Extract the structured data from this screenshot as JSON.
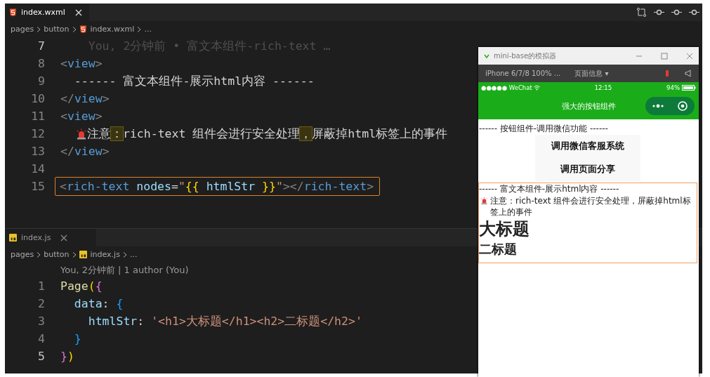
{
  "editor_top": {
    "tab": {
      "label": "index.wxml",
      "kind": "wxml",
      "focused": true
    },
    "breadcrumb": [
      {
        "label": "pages"
      },
      {
        "label": "button"
      },
      {
        "label": "index.wxml",
        "kind": "wxml"
      },
      {
        "label": "..."
      }
    ],
    "lines": [
      {
        "number": "7",
        "current": true,
        "boxed": false,
        "segments": [
          {
            "kind": "ghost",
            "text": "    You, 2分钟前 • 富文本组件-rich-text …"
          }
        ]
      },
      {
        "number": "8",
        "current": false,
        "boxed": false,
        "segments": [
          {
            "kind": "punct",
            "text": "<"
          },
          {
            "kind": "tag",
            "text": "view"
          },
          {
            "kind": "punct",
            "text": ">"
          }
        ]
      },
      {
        "number": "9",
        "current": false,
        "boxed": false,
        "segments": [
          {
            "kind": "text",
            "text": "  ------ 富文本组件-展示html内容 ------"
          }
        ]
      },
      {
        "number": "10",
        "current": false,
        "boxed": false,
        "segments": [
          {
            "kind": "punct",
            "text": "</"
          },
          {
            "kind": "tag",
            "text": "view"
          },
          {
            "kind": "punct",
            "text": ">"
          }
        ]
      },
      {
        "number": "11",
        "current": false,
        "boxed": false,
        "segments": [
          {
            "kind": "punct",
            "text": "<"
          },
          {
            "kind": "tag",
            "text": "view"
          },
          {
            "kind": "punct",
            "text": ">"
          }
        ]
      },
      {
        "number": "12",
        "current": false,
        "boxed": false,
        "segments": [
          {
            "kind": "alarm-icon"
          },
          {
            "kind": "text",
            "text": "注意"
          },
          {
            "kind": "box",
            "text": "："
          },
          {
            "kind": "text",
            "text": "rich-text 组件会进行安全处理"
          },
          {
            "kind": "box",
            "text": "，"
          },
          {
            "kind": "text",
            "text": "屏蔽掉html标签上的事件"
          }
        ]
      },
      {
        "number": "13",
        "current": false,
        "boxed": false,
        "segments": [
          {
            "kind": "punct",
            "text": "</"
          },
          {
            "kind": "tag",
            "text": "view"
          },
          {
            "kind": "punct",
            "text": ">"
          }
        ]
      },
      {
        "number": "14",
        "current": false
      },
      {
        "number": "15",
        "current": false,
        "boxed": true,
        "segments": [
          {
            "kind": "punct",
            "text": "<"
          },
          {
            "kind": "tag",
            "text": "rich-text"
          },
          {
            "kind": "attr",
            "text": " nodes"
          },
          {
            "kind": "text",
            "text": "="
          },
          {
            "kind": "str",
            "text": "\""
          },
          {
            "kind": "brace",
            "text": "{{"
          },
          {
            "kind": "attr",
            "text": " htmlStr "
          },
          {
            "kind": "brace",
            "text": "}}"
          },
          {
            "kind": "str",
            "text": "\""
          },
          {
            "kind": "punct",
            "text": "></"
          },
          {
            "kind": "tag",
            "text": "rich-text"
          },
          {
            "kind": "punct",
            "text": ">"
          }
        ]
      }
    ]
  },
  "editor_bottom": {
    "tab": {
      "label": "index.js",
      "kind": "js",
      "focused": false
    },
    "breadcrumb": [
      {
        "label": "pages"
      },
      {
        "label": "button"
      },
      {
        "label": "index.js",
        "kind": "js"
      },
      {
        "label": "..."
      }
    ],
    "blame": "You, 2分钟前 | 1 author (You)",
    "lines": [
      {
        "number": "1",
        "current": false,
        "boxed": false,
        "segments": [
          {
            "kind": "fn",
            "text": "Page"
          },
          {
            "kind": "brace",
            "text": "("
          },
          {
            "kind": "pink",
            "text": "{"
          }
        ]
      },
      {
        "number": "2",
        "current": false,
        "boxed": false,
        "segments": [
          {
            "kind": "attr",
            "text": "  data"
          },
          {
            "kind": "text",
            "text": ": "
          },
          {
            "kind": "blue",
            "text": "{"
          }
        ]
      },
      {
        "number": "3",
        "current": false,
        "boxed": false,
        "segments": [
          {
            "kind": "attr",
            "text": "    htmlStr"
          },
          {
            "kind": "text",
            "text": ": "
          },
          {
            "kind": "str",
            "text": "'<h1>大标题</h1><h2>二标题</h2>'"
          }
        ]
      },
      {
        "number": "4",
        "current": false,
        "boxed": false,
        "segments": [
          {
            "kind": "blue",
            "text": "  }"
          }
        ]
      },
      {
        "number": "5",
        "current": true,
        "boxed": false,
        "segments": [
          {
            "kind": "pink",
            "text": "}"
          },
          {
            "kind": "brace",
            "text": ")"
          }
        ]
      }
    ]
  },
  "simulator": {
    "title": "mini-base的模拟器",
    "device": "iPhone 6/7/8 100% ...",
    "page_info": "页面信息 ▾",
    "status": {
      "carrier": "●●●●● WeChat",
      "time": "12:15",
      "battery": "94%"
    },
    "nav_title": "强大的按钮组件",
    "sections": [
      {
        "outlined": false,
        "items": [
          {
            "kind": "text",
            "text": "------ 按钮组件-调用微信功能 ------"
          },
          {
            "kind": "button",
            "text": "调用微信客服系统"
          },
          {
            "kind": "button",
            "text": "调用页面分享"
          }
        ]
      },
      {
        "outlined": true,
        "items": [
          {
            "kind": "text",
            "text": "------ 富文本组件-展示html内容 ------"
          },
          {
            "kind": "notice",
            "text": "注意：rich-text 组件会进行安全处理，屏蔽掉html标签上的事件"
          },
          {
            "kind": "h1",
            "text": "大标题"
          },
          {
            "kind": "h2",
            "text": "二标题"
          }
        ]
      }
    ]
  }
}
